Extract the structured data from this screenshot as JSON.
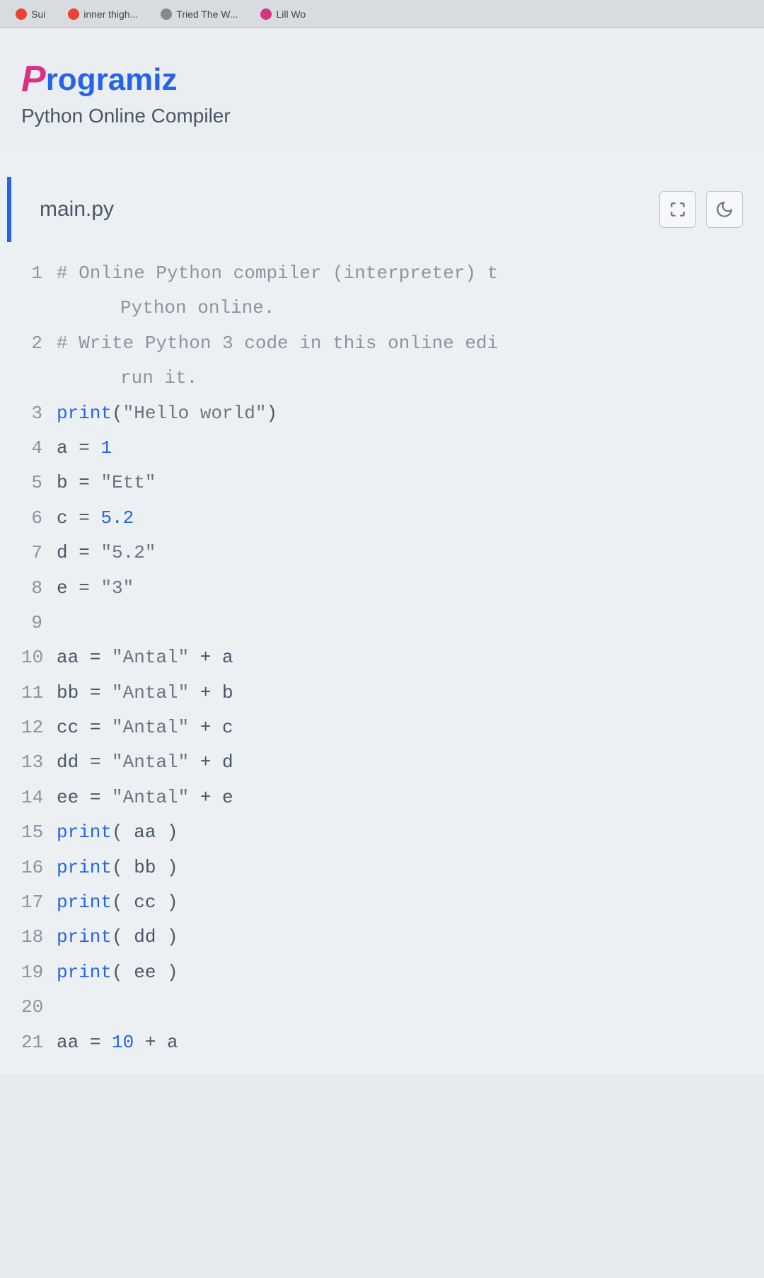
{
  "browser": {
    "tabs": [
      {
        "label": "Sui",
        "icon_color": "#ea4335"
      },
      {
        "label": "inner thigh...",
        "icon_color": "#ea4335"
      },
      {
        "label": "Tried The W...",
        "icon_color": "#888888"
      },
      {
        "label": "Lill Wo",
        "icon_color": "#d63384"
      }
    ]
  },
  "header": {
    "logo_first": "P",
    "logo_rest": "rogramiz",
    "subtitle": "Python Online Compiler"
  },
  "editor": {
    "filename": "main.py",
    "expand_icon": "expand-icon",
    "theme_icon": "moon-icon"
  },
  "code": {
    "lines": [
      {
        "n": "1",
        "tokens": [
          {
            "t": "# Online Python compiler (interpreter) t",
            "c": "comment"
          }
        ]
      },
      {
        "n": "",
        "wrapped": true,
        "tokens": [
          {
            "t": "Python online.",
            "c": "comment"
          }
        ]
      },
      {
        "n": "2",
        "tokens": [
          {
            "t": "# Write Python 3 code in this online edi",
            "c": "comment"
          }
        ]
      },
      {
        "n": "",
        "wrapped": true,
        "tokens": [
          {
            "t": "run it.",
            "c": "comment"
          }
        ]
      },
      {
        "n": "3",
        "tokens": [
          {
            "t": "print",
            "c": "keyword"
          },
          {
            "t": "(",
            "c": "op"
          },
          {
            "t": "\"Hello world\"",
            "c": "string"
          },
          {
            "t": ")",
            "c": "op"
          }
        ]
      },
      {
        "n": "4",
        "tokens": [
          {
            "t": "a ",
            "c": "var"
          },
          {
            "t": "= ",
            "c": "op"
          },
          {
            "t": "1",
            "c": "number"
          }
        ]
      },
      {
        "n": "5",
        "tokens": [
          {
            "t": "b ",
            "c": "var"
          },
          {
            "t": "= ",
            "c": "op"
          },
          {
            "t": "\"Ett\"",
            "c": "string"
          }
        ]
      },
      {
        "n": "6",
        "tokens": [
          {
            "t": "c ",
            "c": "var"
          },
          {
            "t": "= ",
            "c": "op"
          },
          {
            "t": "5.2",
            "c": "number"
          }
        ]
      },
      {
        "n": "7",
        "tokens": [
          {
            "t": "d ",
            "c": "var"
          },
          {
            "t": "= ",
            "c": "op"
          },
          {
            "t": "\"5.2\"",
            "c": "string"
          }
        ]
      },
      {
        "n": "8",
        "tokens": [
          {
            "t": "e ",
            "c": "var"
          },
          {
            "t": "= ",
            "c": "op"
          },
          {
            "t": "\"3\"",
            "c": "string"
          }
        ]
      },
      {
        "n": "9",
        "tokens": [
          {
            "t": "",
            "c": "var"
          }
        ]
      },
      {
        "n": "10",
        "tokens": [
          {
            "t": "aa ",
            "c": "var"
          },
          {
            "t": "= ",
            "c": "op"
          },
          {
            "t": "\"Antal\"",
            "c": "string"
          },
          {
            "t": " + a",
            "c": "var"
          }
        ]
      },
      {
        "n": "11",
        "tokens": [
          {
            "t": "bb ",
            "c": "var"
          },
          {
            "t": "= ",
            "c": "op"
          },
          {
            "t": "\"Antal\"",
            "c": "string"
          },
          {
            "t": " + b",
            "c": "var"
          }
        ]
      },
      {
        "n": "12",
        "tokens": [
          {
            "t": "cc ",
            "c": "var"
          },
          {
            "t": "= ",
            "c": "op"
          },
          {
            "t": "\"Antal\"",
            "c": "string"
          },
          {
            "t": " + c",
            "c": "var"
          }
        ]
      },
      {
        "n": "13",
        "tokens": [
          {
            "t": "dd ",
            "c": "var"
          },
          {
            "t": "= ",
            "c": "op"
          },
          {
            "t": "\"Antal\"",
            "c": "string"
          },
          {
            "t": " + d",
            "c": "var"
          }
        ]
      },
      {
        "n": "14",
        "tokens": [
          {
            "t": "ee ",
            "c": "var"
          },
          {
            "t": "= ",
            "c": "op"
          },
          {
            "t": "\"Antal\"",
            "c": "string"
          },
          {
            "t": " + e",
            "c": "var"
          }
        ]
      },
      {
        "n": "15",
        "tokens": [
          {
            "t": "print",
            "c": "keyword"
          },
          {
            "t": "( aa )",
            "c": "var"
          }
        ]
      },
      {
        "n": "16",
        "tokens": [
          {
            "t": "print",
            "c": "keyword"
          },
          {
            "t": "( bb )",
            "c": "var"
          }
        ]
      },
      {
        "n": "17",
        "tokens": [
          {
            "t": "print",
            "c": "keyword"
          },
          {
            "t": "( cc )",
            "c": "var"
          }
        ]
      },
      {
        "n": "18",
        "tokens": [
          {
            "t": "print",
            "c": "keyword"
          },
          {
            "t": "( dd )",
            "c": "var"
          }
        ]
      },
      {
        "n": "19",
        "tokens": [
          {
            "t": "print",
            "c": "keyword"
          },
          {
            "t": "( ee )",
            "c": "var"
          }
        ]
      },
      {
        "n": "20",
        "tokens": [
          {
            "t": "",
            "c": "var"
          }
        ]
      },
      {
        "n": "21",
        "tokens": [
          {
            "t": "aa ",
            "c": "var"
          },
          {
            "t": "= ",
            "c": "op"
          },
          {
            "t": "10",
            "c": "number"
          },
          {
            "t": " + a",
            "c": "var"
          }
        ]
      }
    ]
  }
}
